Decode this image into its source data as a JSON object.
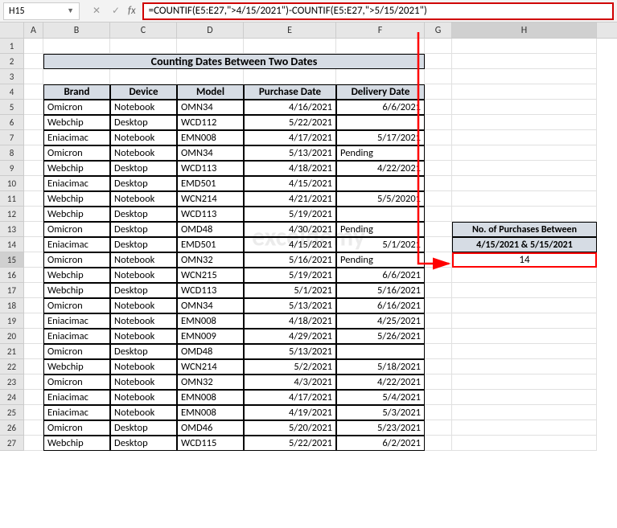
{
  "nameBox": "H15",
  "formula": "=COUNTIF(E5:E27,\">4/15/2021\")-COUNTIF(E5:E27,\">5/15/2021\")",
  "fxLabel": "fx",
  "columns": [
    "A",
    "B",
    "C",
    "D",
    "E",
    "F",
    "G",
    "H"
  ],
  "title": "Counting Dates Between Two Dates",
  "headers": {
    "brand": "Brand",
    "device": "Device",
    "model": "Model",
    "purchase": "Purchase Date",
    "delivery": "Delivery Date"
  },
  "resultHeader1": "No. of Purchases Between",
  "resultHeader2": "4/15/2021 & 5/15/2021",
  "resultValue": "14",
  "watermark": "exceldemy",
  "chart_data": {
    "type": "table",
    "title": "Counting Dates Between Two Dates",
    "columns": [
      "Brand",
      "Device",
      "Model",
      "Purchase Date",
      "Delivery Date"
    ],
    "rows": [
      [
        "Omicron",
        "Notebook",
        "OMN34",
        "4/16/2021",
        "6/6/2021"
      ],
      [
        "Webchip",
        "Desktop",
        "WCD112",
        "5/22/2021",
        ""
      ],
      [
        "Eniacimac",
        "Notebook",
        "EMN008",
        "4/17/2021",
        "5/17/2021"
      ],
      [
        "Omicron",
        "Notebook",
        "OMN34",
        "5/13/2021",
        "Pending"
      ],
      [
        "Webchip",
        "Desktop",
        "WCD113",
        "4/18/2021",
        "4/22/2021"
      ],
      [
        "Eniacimac",
        "Desktop",
        "EMD501",
        "4/15/2021",
        ""
      ],
      [
        "Webchip",
        "Notebook",
        "WCN214",
        "4/21/2021",
        "5/5/20201"
      ],
      [
        "Webchip",
        "Desktop",
        "WCD113",
        "5/19/2021",
        ""
      ],
      [
        "Omicron",
        "Desktop",
        "OMD48",
        "4/30/2021",
        "Pending"
      ],
      [
        "Eniacimac",
        "Desktop",
        "EMD501",
        "4/15/2021",
        "5/1/2021"
      ],
      [
        "Omicron",
        "Notebook",
        "OMN32",
        "5/16/2021",
        "Pending"
      ],
      [
        "Webchip",
        "Notebook",
        "WCN215",
        "5/19/2021",
        "6/6/2021"
      ],
      [
        "Webchip",
        "Desktop",
        "WCD113",
        "5/1/2021",
        "5/16/2021"
      ],
      [
        "Omicron",
        "Notebook",
        "OMN34",
        "5/13/2021",
        "6/16/2021"
      ],
      [
        "Eniacimac",
        "Notebook",
        "EMN008",
        "4/18/2021",
        "4/25/2021"
      ],
      [
        "Eniacimac",
        "Notebook",
        "EMN009",
        "4/29/2021",
        "5/26/2021"
      ],
      [
        "Omicron",
        "Desktop",
        "OMD48",
        "5/13/2021",
        ""
      ],
      [
        "Webchip",
        "Notebook",
        "WCN214",
        "5/2/2021",
        "5/18/2021"
      ],
      [
        "Omicron",
        "Notebook",
        "OMN32",
        "4/3/2021",
        "4/22/2021"
      ],
      [
        "Eniacimac",
        "Notebook",
        "EMN008",
        "4/17/2021",
        "5/4/2021"
      ],
      [
        "Eniacimac",
        "Notebook",
        "EMN008",
        "4/19/2021",
        "5/3/2021"
      ],
      [
        "Omicron",
        "Desktop",
        "OMD46",
        "5/20/2021",
        "5/23/2021"
      ],
      [
        "Webchip",
        "Desktop",
        "WCD115",
        "5/22/2021",
        "6/2/2021"
      ]
    ]
  }
}
